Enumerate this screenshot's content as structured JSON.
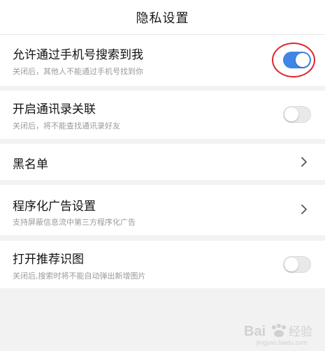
{
  "header": {
    "title": "隐私设置"
  },
  "settings": [
    {
      "title": "允许通过手机号搜索到我",
      "subtitle": "关闭后，其他人不能通过手机号找到你",
      "control": "toggle",
      "state": "on"
    },
    {
      "title": "开启通讯录关联",
      "subtitle": "关闭后，将不能查找通讯录好友",
      "control": "toggle",
      "state": "off"
    },
    {
      "title": "黑名单",
      "control": "chevron-right-icon"
    },
    {
      "title": "程序化广告设置",
      "subtitle": "支持屏蔽信息流中第三方程序化广告",
      "control": "chevron-right-icon"
    },
    {
      "title": "打开推荐识图",
      "subtitle": "关闭后,搜索时将不能自动弹出新增图片",
      "control": "toggle",
      "state": "off"
    }
  ],
  "annotation": {
    "color": "#e0262d"
  },
  "colors": {
    "toggle_on": "#3f86e6",
    "toggle_off": "#e9e9e9",
    "background": "#f2f2f2"
  },
  "watermark": {
    "text": "Bai经验",
    "sub": "jingyan.baidu.com"
  }
}
